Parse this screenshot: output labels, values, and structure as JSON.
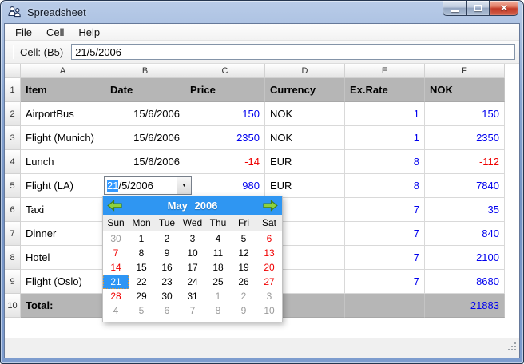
{
  "window": {
    "title": "Spreadsheet"
  },
  "menu": {
    "items": [
      "File",
      "Cell",
      "Help"
    ]
  },
  "toolbar": {
    "cell_label": "Cell: (B5)",
    "cell_value": "21/5/2006"
  },
  "colors": {
    "positive_value_blue": "#0000ee",
    "negative_value_red": "#ee0000",
    "header_row_gray": "#b6b6b6",
    "calendar_header_blue": "#2f96f2",
    "selected_day_blue": "#2e96f5",
    "weekend_red": "#f00000",
    "outside_month_gray": "#9b9b9b"
  },
  "spreadsheet": {
    "column_headers": [
      "A",
      "B",
      "C",
      "D",
      "E",
      "F"
    ],
    "rows": [
      {
        "num": "1",
        "gray": true,
        "cells": [
          {
            "t": "Item",
            "b": 1
          },
          {
            "t": "Date",
            "b": 1
          },
          {
            "t": "Price",
            "b": 1
          },
          {
            "t": "Currency",
            "b": 1
          },
          {
            "t": "Ex.Rate",
            "b": 1
          },
          {
            "t": "NOK",
            "b": 1
          }
        ]
      },
      {
        "num": "2",
        "cells": [
          {
            "t": "AirportBus"
          },
          {
            "t": "15/6/2006",
            "a": "r"
          },
          {
            "t": "150",
            "a": "r",
            "c": "blue"
          },
          {
            "t": "NOK"
          },
          {
            "t": "1",
            "a": "r",
            "c": "blue"
          },
          {
            "t": "150",
            "a": "r",
            "c": "blue"
          }
        ]
      },
      {
        "num": "3",
        "cells": [
          {
            "t": "Flight (Munich)"
          },
          {
            "t": "15/6/2006",
            "a": "r"
          },
          {
            "t": "2350",
            "a": "r",
            "c": "blue"
          },
          {
            "t": "NOK"
          },
          {
            "t": "1",
            "a": "r",
            "c": "blue"
          },
          {
            "t": "2350",
            "a": "r",
            "c": "blue"
          }
        ]
      },
      {
        "num": "4",
        "cells": [
          {
            "t": "Lunch"
          },
          {
            "t": "15/6/2006",
            "a": "r"
          },
          {
            "t": "-14",
            "a": "r",
            "c": "red"
          },
          {
            "t": "EUR"
          },
          {
            "t": "8",
            "a": "r",
            "c": "blue"
          },
          {
            "t": "-112",
            "a": "r",
            "c": "red"
          }
        ]
      },
      {
        "num": "5",
        "cells": [
          {
            "t": "Flight (LA)"
          },
          {
            "ed": true
          },
          {
            "t": "980",
            "a": "r",
            "c": "blue"
          },
          {
            "t": "EUR"
          },
          {
            "t": "8",
            "a": "r",
            "c": "blue"
          },
          {
            "t": "7840",
            "a": "r",
            "c": "blue"
          }
        ]
      },
      {
        "num": "6",
        "cells": [
          {
            "t": "Taxi"
          },
          {
            "t": ""
          },
          {
            "t": ""
          },
          {
            "t": ""
          },
          {
            "t": "7",
            "a": "r",
            "c": "blue"
          },
          {
            "t": "35",
            "a": "r",
            "c": "blue"
          }
        ]
      },
      {
        "num": "7",
        "cells": [
          {
            "t": "Dinner"
          },
          {
            "t": ""
          },
          {
            "t": ""
          },
          {
            "t": ""
          },
          {
            "t": "7",
            "a": "r",
            "c": "blue"
          },
          {
            "t": "840",
            "a": "r",
            "c": "blue"
          }
        ]
      },
      {
        "num": "8",
        "cells": [
          {
            "t": "Hotel"
          },
          {
            "t": ""
          },
          {
            "t": ""
          },
          {
            "t": ""
          },
          {
            "t": "7",
            "a": "r",
            "c": "blue"
          },
          {
            "t": "2100",
            "a": "r",
            "c": "blue"
          }
        ]
      },
      {
        "num": "9",
        "cells": [
          {
            "t": "Flight (Oslo)"
          },
          {
            "t": ""
          },
          {
            "t": ""
          },
          {
            "t": ""
          },
          {
            "t": "7",
            "a": "r",
            "c": "blue"
          },
          {
            "t": "8680",
            "a": "r",
            "c": "blue"
          }
        ]
      },
      {
        "num": "10",
        "gray": true,
        "cells": [
          {
            "t": "Total:",
            "b": 1
          },
          {
            "t": ""
          },
          {
            "t": ""
          },
          {
            "t": ""
          },
          {
            "t": ""
          },
          {
            "t": "21883",
            "a": "r",
            "c": "blue"
          }
        ]
      }
    ]
  },
  "editor": {
    "selected_part": "21",
    "rest_part": "/5/2006"
  },
  "calendar": {
    "title": "May 2006",
    "day_names": [
      {
        "t": "Sun",
        "k": "we"
      },
      {
        "t": "Mon"
      },
      {
        "t": "Tue"
      },
      {
        "t": "Wed"
      },
      {
        "t": "Thu"
      },
      {
        "t": "Fri"
      },
      {
        "t": "Sat",
        "k": "we"
      }
    ],
    "weeks": [
      [
        {
          "t": "30",
          "k": "out"
        },
        {
          "t": "1"
        },
        {
          "t": "2"
        },
        {
          "t": "3"
        },
        {
          "t": "4"
        },
        {
          "t": "5"
        },
        {
          "t": "6",
          "k": "we"
        }
      ],
      [
        {
          "t": "7",
          "k": "we"
        },
        {
          "t": "8"
        },
        {
          "t": "9"
        },
        {
          "t": "10"
        },
        {
          "t": "11"
        },
        {
          "t": "12"
        },
        {
          "t": "13",
          "k": "we"
        }
      ],
      [
        {
          "t": "14",
          "k": "we"
        },
        {
          "t": "15"
        },
        {
          "t": "16"
        },
        {
          "t": "17"
        },
        {
          "t": "18"
        },
        {
          "t": "19"
        },
        {
          "t": "20",
          "k": "we"
        }
      ],
      [
        {
          "t": "21",
          "k": "sel"
        },
        {
          "t": "22"
        },
        {
          "t": "23"
        },
        {
          "t": "24"
        },
        {
          "t": "25"
        },
        {
          "t": "26"
        },
        {
          "t": "27",
          "k": "we"
        }
      ],
      [
        {
          "t": "28",
          "k": "we"
        },
        {
          "t": "29"
        },
        {
          "t": "30"
        },
        {
          "t": "31"
        },
        {
          "t": "1",
          "k": "out"
        },
        {
          "t": "2",
          "k": "out"
        },
        {
          "t": "3",
          "k": "out"
        }
      ],
      [
        {
          "t": "4",
          "k": "out"
        },
        {
          "t": "5",
          "k": "out"
        },
        {
          "t": "6",
          "k": "out"
        },
        {
          "t": "7",
          "k": "out"
        },
        {
          "t": "8",
          "k": "out"
        },
        {
          "t": "9",
          "k": "out"
        },
        {
          "t": "10",
          "k": "out"
        }
      ]
    ]
  }
}
